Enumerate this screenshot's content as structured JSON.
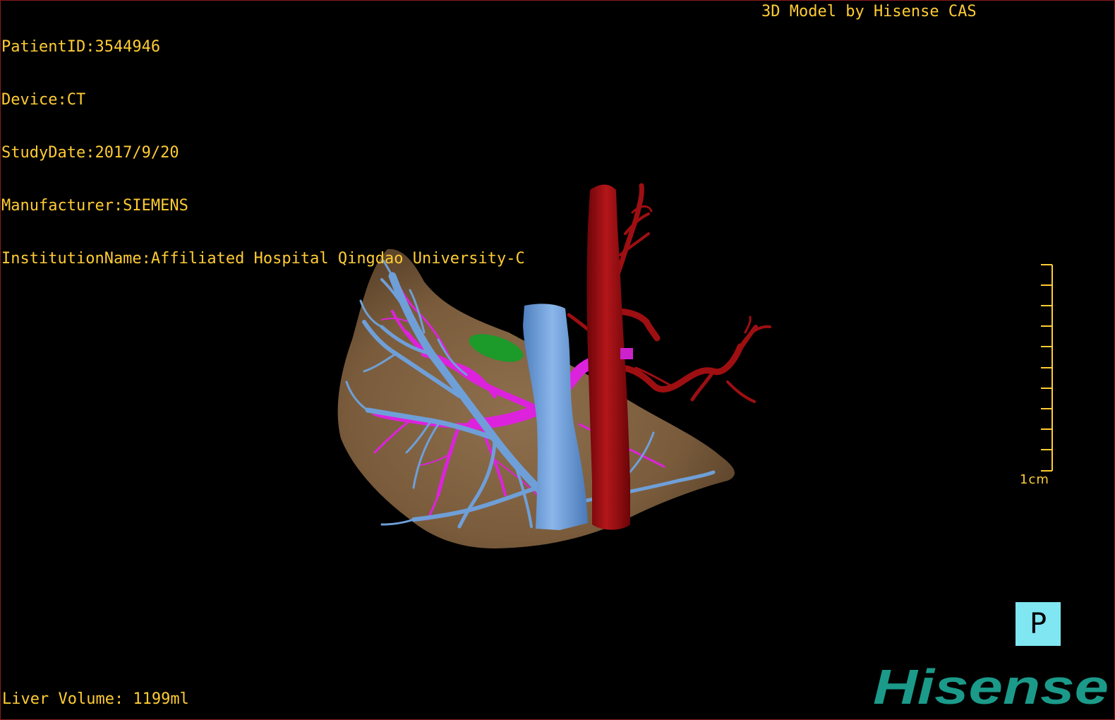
{
  "overlay": {
    "patient_id": "PatientID:3544946",
    "device": "Device:CT",
    "study_date": "StudyDate:2017/9/20",
    "manufacturer": "Manufacturer:SIEMENS",
    "institution": "InstitutionName:Affiliated Hospital Qingdao University-C",
    "credit": "3D Model by Hisense CAS",
    "liver_volume": "Liver Volume: 1199ml"
  },
  "scale_bar": {
    "label": "1cm"
  },
  "orientation": {
    "label": "P"
  },
  "logo": {
    "text": "Hisense"
  },
  "colors": {
    "overlay_text": "#ffcc33",
    "liver": "#8c6b47",
    "hepatic_vein": "#6f9fd8",
    "portal_vein": "#dd22dd",
    "artery": "#9e0f12",
    "gallbladder": "#1c9a2a",
    "orientation_bg": "#7fe6f2",
    "logo": "#1b9a8a"
  }
}
